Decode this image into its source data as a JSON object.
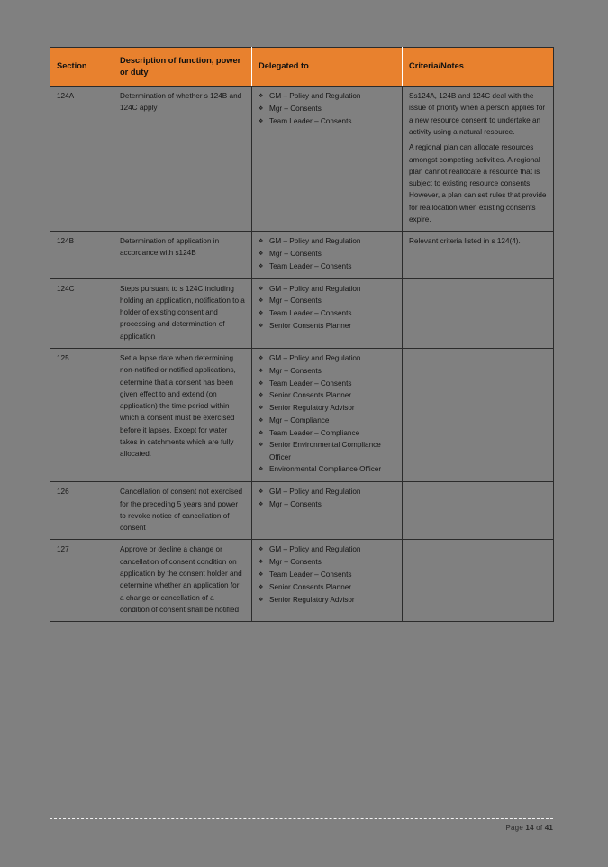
{
  "document": {
    "table": {
      "headers": [
        "Section",
        "Description of function, power or duty",
        "Delegated to",
        "Criteria/Notes"
      ],
      "header_bg": "#E8812E",
      "rows": [
        {
          "section": "124A",
          "description": "Determination of whether s 124B and 124C apply",
          "delegated_to": [
            "GM – Policy and Regulation",
            "Mgr – Consents",
            "Team Leader – Consents"
          ],
          "criteria_paragraphs": [
            "Ss124A, 124B and 124C deal with the issue of priority when a person applies for a new resource consent to undertake an activity using a natural resource.",
            "A regional plan can allocate resources amongst competing activities. A regional plan cannot reallocate a resource that is subject to existing resource consents. However, a plan can set rules that provide for reallocation when existing consents expire."
          ]
        },
        {
          "section": "124B",
          "description": "Determination of application in accordance with s124B",
          "delegated_to": [
            "GM – Policy and Regulation",
            "Mgr – Consents",
            "Team Leader – Consents"
          ],
          "criteria_paragraphs": [
            "Relevant criteria listed in s 124(4)."
          ]
        },
        {
          "section": "124C",
          "description": "Steps pursuant to s 124C including holding an application, notification to a holder of existing consent and processing and determination of application",
          "delegated_to": [
            "GM – Policy and Regulation",
            "Mgr – Consents",
            "Team Leader – Consents",
            "Senior Consents Planner"
          ],
          "criteria_paragraphs": []
        },
        {
          "section": "125",
          "description": "Set a lapse date when determining non-notified or notified applications, determine that a consent has been given effect to and extend (on application) the time period within which a consent must be exercised before it lapses. Except for water takes in catchments which are fully allocated.",
          "delegated_to": [
            "GM – Policy and Regulation",
            "Mgr – Consents",
            "Team Leader – Consents",
            "Senior Consents Planner",
            "Senior Regulatory Advisor",
            "Mgr – Compliance",
            "Team Leader – Compliance",
            "Senior Environmental Compliance Officer",
            "Environmental Compliance Officer"
          ],
          "criteria_paragraphs": []
        },
        {
          "section": "126",
          "description": "Cancellation of consent not exercised for the preceding 5 years and power to revoke notice of cancellation of consent",
          "delegated_to": [
            "GM – Policy and Regulation",
            "Mgr – Consents"
          ],
          "criteria_paragraphs": []
        },
        {
          "section": "127",
          "description": "Approve or decline a change or cancellation of consent condition on application by the consent holder and determine whether an application for a change or cancellation of a condition of consent shall be notified",
          "delegated_to": [
            "GM – Policy and Regulation",
            "Mgr – Consents",
            "Team Leader – Consents",
            "Senior Consents Planner",
            "Senior Regulatory Advisor"
          ],
          "criteria_paragraphs": []
        }
      ]
    },
    "footer": {
      "page_label": "Page",
      "page_number": "14",
      "of_label": "of",
      "total_pages": "41"
    }
  }
}
